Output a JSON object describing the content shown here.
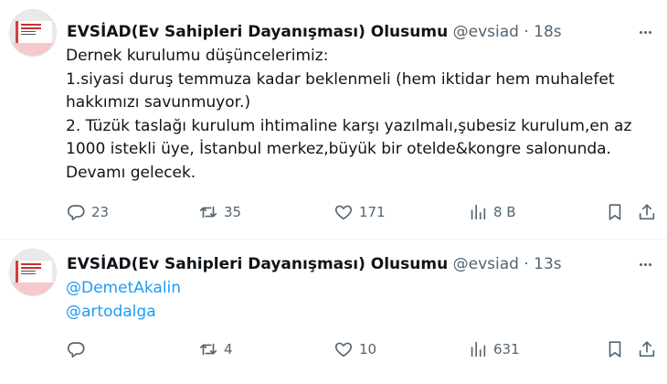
{
  "tweets": [
    {
      "author_name": "EVSİAD(Ev Sahipleri Dayanışması) Olusumu",
      "handle": "@evsiad",
      "separator": "·",
      "time": "18s",
      "lines": [
        "Dernek kurulumu düşüncelerimiz:",
        "1.siyasi duruş temmuza kadar beklenmeli (hem iktidar hem muhalefet",
        "hakkımızı savunmuyor.)",
        "2. Tüzük taslağı kurulum ihtimaline karşı yazılmalı,şubesiz kurulum,en az",
        "1000 istekli üye, İstanbul merkez,büyük bir otelde&kongre salonunda.",
        "Devamı gelecek."
      ],
      "replies": "23",
      "retweets": "35",
      "likes": "171",
      "views": "8 B"
    },
    {
      "author_name": "EVSİAD(Ev Sahipleri Dayanışması) Olusumu",
      "handle": "@evsiad",
      "separator": "·",
      "time": "13s",
      "mentions": [
        "@DemetAkalin",
        "@artodalga"
      ],
      "replies": "",
      "retweets": "4",
      "likes": "10",
      "views": "631"
    }
  ],
  "colors": {
    "text": "#0f1419",
    "secondary": "#536471",
    "link": "#1d9bf0",
    "divider": "#eff3f4"
  },
  "icons": [
    "reply-icon",
    "retweet-icon",
    "like-icon",
    "views-icon",
    "bookmark-icon",
    "share-icon",
    "more-icon"
  ]
}
